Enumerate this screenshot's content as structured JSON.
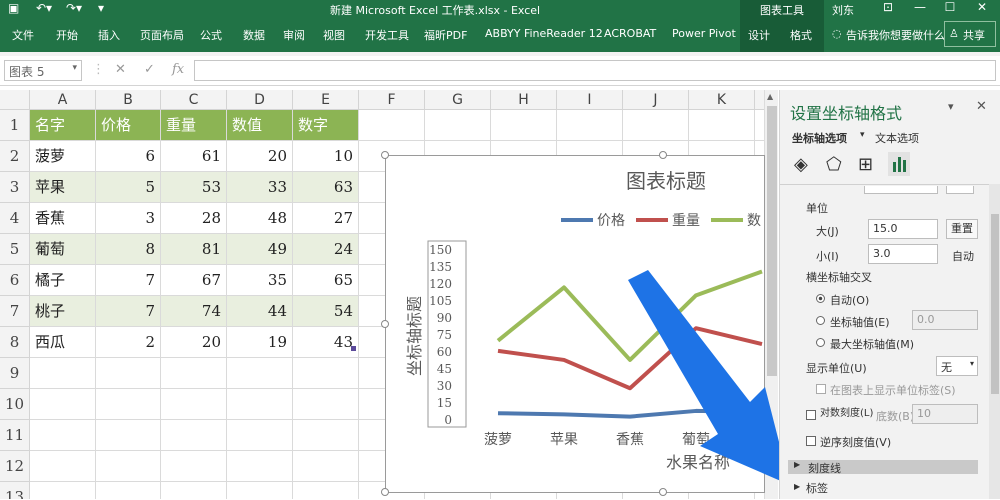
{
  "titlebar": {
    "title": "新建 Microsoft Excel 工作表.xlsx - Excel",
    "context_tools": "图表工具",
    "user": "刘东"
  },
  "ribbon": {
    "tabs": [
      "文件",
      "开始",
      "插入",
      "页面布局",
      "公式",
      "数据",
      "审阅",
      "视图",
      "开发工具",
      "福昕PDF",
      "ABBYY FineReader 12",
      "ACROBAT",
      "Power Pivot"
    ],
    "context_tabs": [
      "设计",
      "格式"
    ],
    "tell_me": "告诉我你想要做什么",
    "share": "共享"
  },
  "formula_bar": {
    "name_box": "图表 5",
    "fx": "fx",
    "value": ""
  },
  "sheet": {
    "columns": [
      "A",
      "B",
      "C",
      "D",
      "E",
      "F",
      "G",
      "H",
      "I",
      "J",
      "K",
      "L"
    ],
    "rows": [
      "1",
      "2",
      "3",
      "4",
      "5",
      "6",
      "7",
      "8",
      "9",
      "10",
      "11",
      "12",
      "13"
    ],
    "header": [
      "名字",
      "价格",
      "重量",
      "数值",
      "数字"
    ],
    "data": [
      [
        "菠萝",
        "6",
        "61",
        "20",
        "10"
      ],
      [
        "苹果",
        "5",
        "53",
        "33",
        "63"
      ],
      [
        "香蕉",
        "3",
        "28",
        "48",
        "27"
      ],
      [
        "葡萄",
        "8",
        "81",
        "49",
        "24"
      ],
      [
        "橘子",
        "7",
        "67",
        "35",
        "65"
      ],
      [
        "桃子",
        "7",
        "74",
        "44",
        "54"
      ],
      [
        "西瓜",
        "2",
        "20",
        "19",
        "43"
      ]
    ]
  },
  "chart_data": {
    "type": "line",
    "title": "图表标题",
    "ylabel": "坐标轴标题",
    "xlabel": "水果名称",
    "categories": [
      "菠萝",
      "苹果",
      "香蕉",
      "葡萄",
      "橘子",
      "桃子",
      "西瓜"
    ],
    "visible_categories": [
      "菠萝",
      "苹果",
      "香蕉",
      "葡萄"
    ],
    "ylim": [
      0,
      150
    ],
    "yticks": [
      "150",
      "135",
      "120",
      "105",
      "90",
      "75",
      "60",
      "45",
      "30",
      "15",
      "0"
    ],
    "series": [
      {
        "name": "价格",
        "values": [
          6,
          5,
          3,
          8,
          7,
          7,
          2
        ],
        "color": "#4e79b0"
      },
      {
        "name": "重量",
        "values": [
          61,
          53,
          28,
          81,
          67,
          74,
          20
        ],
        "color": "#c0504d"
      },
      {
        "name": "数",
        "values": [
          70,
          117,
          53,
          110,
          131,
          0,
          0
        ],
        "color": "#9bbb59"
      }
    ],
    "legend_position": "top"
  },
  "pane": {
    "title": "设置坐标轴格式",
    "tab_axis": "坐标轴选项",
    "tab_text": "文本选项",
    "units_label": "单位",
    "major_label": "大(J)",
    "major_value": "15.0",
    "major_btn": "重置",
    "minor_label": "小(I)",
    "minor_value": "3.0",
    "minor_btn": "自动",
    "cross_label": "横坐标轴交叉",
    "opt_auto": "自动(O)",
    "opt_value": "坐标轴值(E)",
    "opt_value_num": "0.0",
    "opt_max": "最大坐标轴值(M)",
    "display_units": "显示单位(U)",
    "display_units_value": "无",
    "show_units_label": "在图表上显示单位标签(S)",
    "log_scale": "对数刻度(L)",
    "base_label": "底数(B)",
    "base_value": "10",
    "reverse": "逆序刻度值(V)",
    "section_tick": "刻度线",
    "section_label": "标签"
  },
  "colors": {
    "accent": "#217346",
    "header_fill": "#8cb454",
    "alt_row": "#e9efdf",
    "arrow": "#1e73e6"
  }
}
